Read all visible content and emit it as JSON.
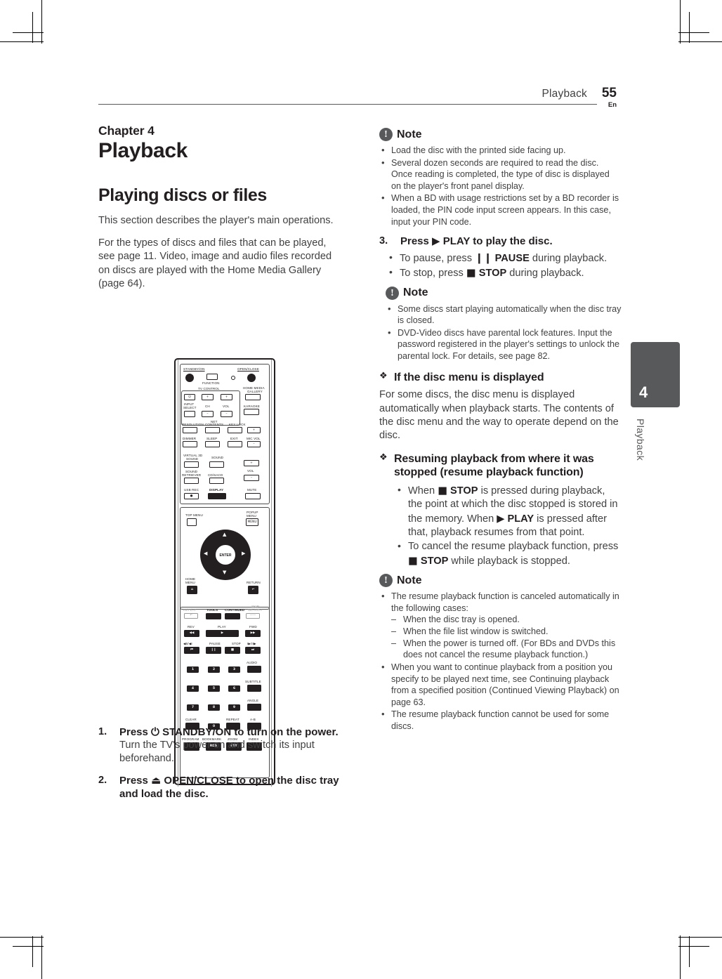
{
  "header": {
    "section": "Playback",
    "page_number": "55",
    "language": "En"
  },
  "side_tab": {
    "number": "4",
    "label": "Playback"
  },
  "left_column": {
    "chapter_label": "Chapter 4",
    "chapter_title": "Playback",
    "section_title": "Playing discs or files",
    "paragraph_1": "This section describes the player's main operations.",
    "paragraph_2": "For the types of discs and files that can be played, see page 11. Video, image and audio files recorded on discs are played with the Home Media Gallery (page 64).",
    "steps": [
      {
        "num": "1.",
        "heading_pre": "Press ",
        "heading_glyph": "⏻",
        "heading_post": " STANDBY/ON to turn on the power.",
        "sub": "Turn the TV's power on and switch its input beforehand."
      },
      {
        "num": "2.",
        "heading_pre": "Press ",
        "heading_glyph": "⏏",
        "heading_post": " OPEN/CLOSE to open the disc tray and load the disc.",
        "sub": ""
      }
    ]
  },
  "right_column": {
    "note_1": {
      "badge": "!",
      "title": "Note",
      "items": [
        "Load the disc with the printed side facing up.",
        "Several dozen seconds are required to read the disc. Once reading is completed, the type of disc is displayed on the player's front panel display.",
        "When a BD with usage restrictions set by a BD recorder is loaded, the PIN code input screen appears. In this case, input your PIN code."
      ]
    },
    "step_3": {
      "num": "3.",
      "heading_pre": "Press ",
      "heading_glyph": "▶",
      "heading_post": " PLAY to play the disc.",
      "bullets": [
        {
          "pre": "To pause, press ",
          "glyph": "❙❙",
          "kw": " PAUSE",
          "post": " during playback."
        },
        {
          "pre": "To stop, press ",
          "glyph": "■",
          "kw": " STOP",
          "post": " during playback."
        }
      ]
    },
    "note_2": {
      "badge": "!",
      "title": "Note",
      "items": [
        "Some discs start playing automatically when the disc tray is closed.",
        "DVD-Video discs have parental lock features. Input the password registered in the player's settings to unlock the parental lock. For details, see page 82."
      ]
    },
    "disc_menu": {
      "heading": "If the disc menu is displayed",
      "body": "For some discs, the disc menu is displayed automatically when playback starts. The contents of the disc menu and the way to operate depend on the disc."
    },
    "resume": {
      "heading": "Resuming playback from where it was stopped (resume playback function)",
      "bullet_1": {
        "p1": "When ",
        "g1": "■",
        "k1": " STOP",
        "p2": " is pressed during playback, the point at which the disc stopped is stored in the memory. When ",
        "g2": "▶",
        "k2": " PLAY",
        "p3": " is pressed after that, playback resumes from that point."
      },
      "bullet_2": {
        "p1": "To cancel the resume playback function, press ",
        "g1": "■",
        "k1": " STOP",
        "p2": " while playback is stopped."
      }
    },
    "note_3": {
      "badge": "!",
      "title": "Note",
      "item_1": "The resume playback function is canceled automatically in the following cases:",
      "sub_items": [
        "When the disc tray is opened.",
        "When the file list window is switched.",
        "When the power is turned off. (For BDs and DVDs this does not cancel the resume playback function.)"
      ],
      "item_2": "When you want to continue playback from a position you specify to be played next time, see Continuing playback from a specified position (Continued Viewing Playback) on page 63.",
      "item_3": "The resume playback function cannot be used for some discs."
    }
  },
  "remote": {
    "caption": "remote-control-illustration",
    "labels": {
      "standby_on": "STANDBY/ON",
      "open_close": "OPEN/CLOSE",
      "function": "FUNCTION",
      "tv_control": "TV CONTROL",
      "home_media_gallery_1": "HOME MEDIA",
      "home_media_gallery_2": "GALLERY",
      "input_select_1": "INPUT",
      "input_select_2": "SELECT",
      "ch": "CH",
      "vol": "VOL",
      "karaoke": "KARAOKE",
      "resolution": "RESOLUTION",
      "net_contents_1": "NET",
      "net_contents_2": "CONTENTS",
      "key_lock": "KEY LOCK",
      "dimmer": "DIMMER",
      "sleep": "SLEEP",
      "exit": "EXIT",
      "mic_vol": "MIC VOL",
      "virtual_3d_1": "VIRTUAL 3D",
      "virtual_3d_2": "SOUND",
      "sound": "SOUND",
      "sound_retriever_1": "SOUND",
      "sound_retriever_2": "RETRIEVER",
      "cd_sacd": "CD/SACD",
      "vol2": "VOL",
      "usb_rec": "USB REC",
      "display": "DISPLAY",
      "mute": "MUTE",
      "top_menu": "TOP MENU",
      "popup_menu_1": "POPUP",
      "popup_menu_2": "MENU",
      "menu_btn": "MENU",
      "enter": "ENTER",
      "home_menu_1": "HOME",
      "home_menu_2": "MENU",
      "return": "RETURN",
      "replay": "REPLAY",
      "tools": "TOOLS",
      "continued": "CONTINUED",
      "skip_search_1": "SKIP",
      "skip_search_2": "SEARCH",
      "rev": "REV",
      "play": "PLAY",
      "fwd": "FWD",
      "prev_step": "◀II/◀I",
      "pause": "PAUSE",
      "stop": "STOP",
      "next_step": "I▶/II▶",
      "audio": "AUDIO",
      "subtitle": "SUBTITLE",
      "angle": "ANGLE",
      "clear": "CLEAR",
      "repeat": "REPEAT",
      "ab": "A-B",
      "program": "PROGRAM",
      "bookmark": "BOOKMARK",
      "zoom": "ZOOM",
      "index": "INDEX",
      "rds": "RDS",
      "pty": "PTY",
      "num_1": "1",
      "num_2": "2",
      "num_3": "3",
      "num_4": "4",
      "num_5": "5",
      "num_6": "6",
      "num_7": "7",
      "num_8": "8",
      "num_9": "9",
      "num_0": "0",
      "plus": "+",
      "minus": "–"
    }
  }
}
